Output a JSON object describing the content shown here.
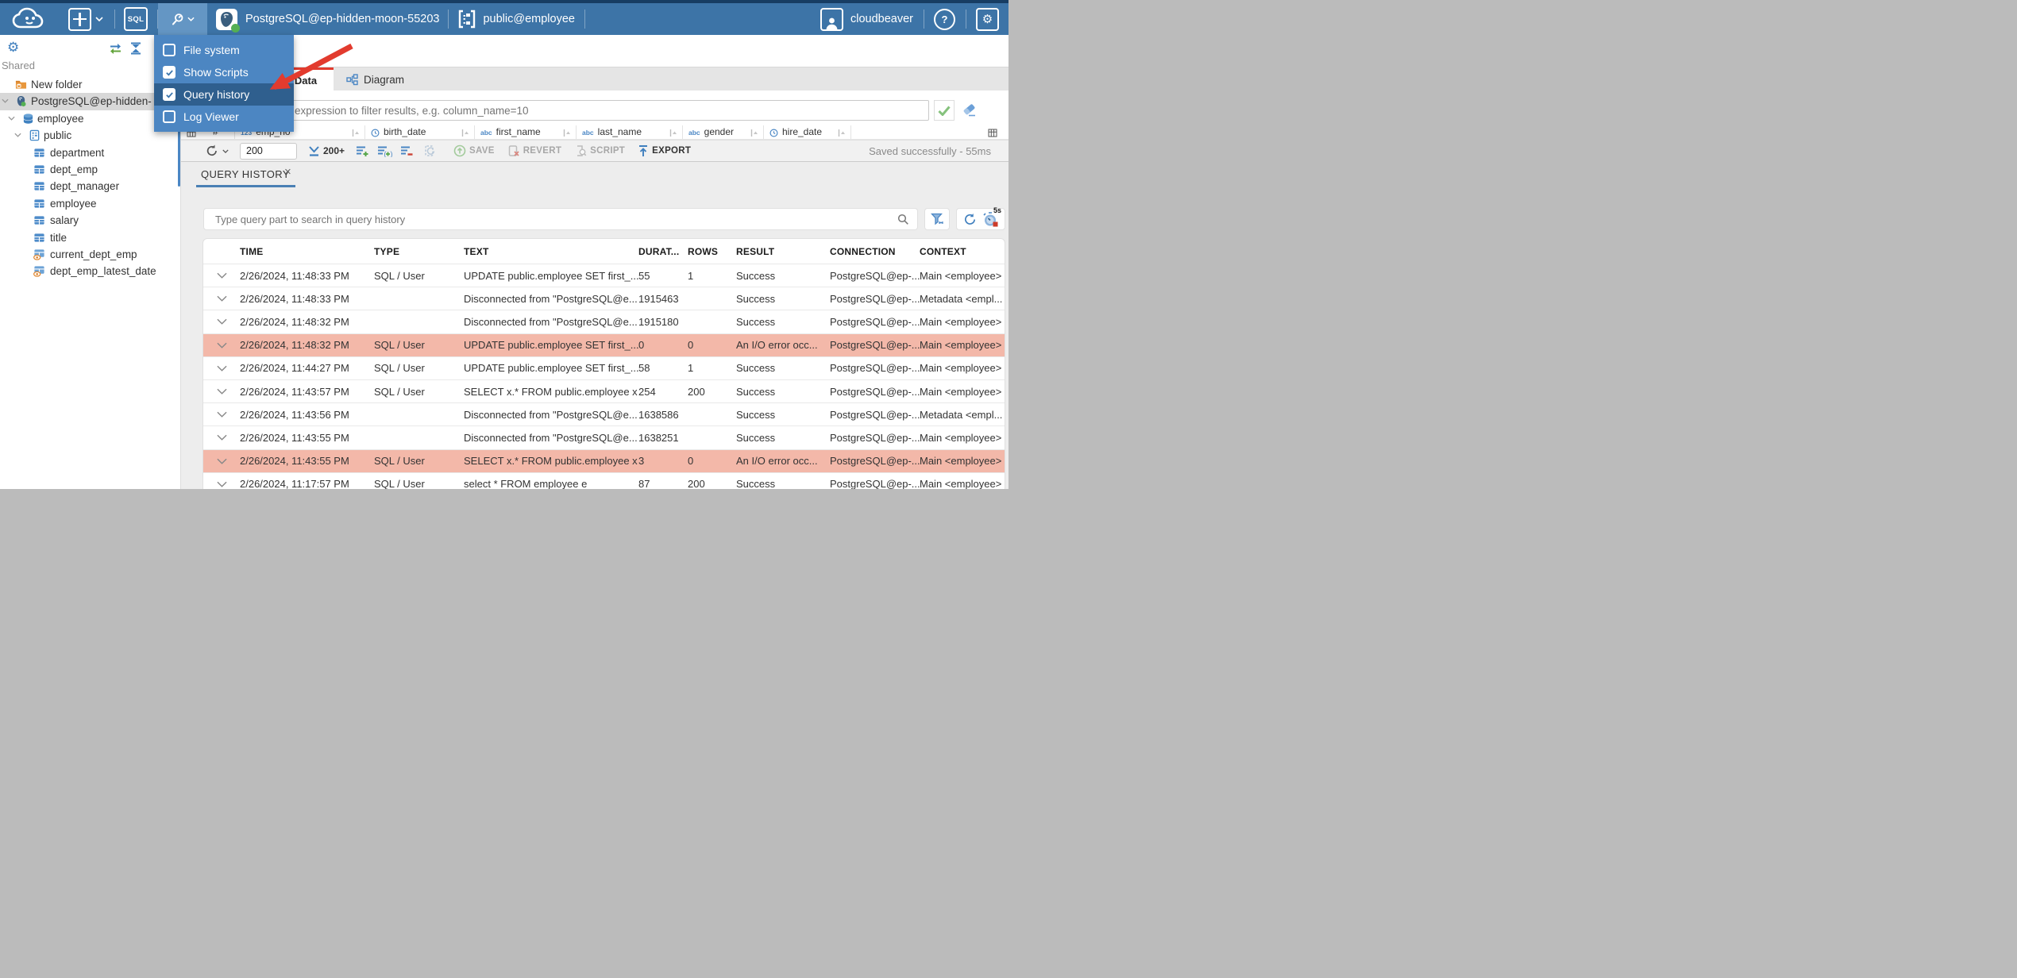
{
  "colors": {
    "topbar": "#3d74a7",
    "menu": "#4c86c2",
    "menu_highlight": "#2f5f8e",
    "accent_red": "#e23b2e",
    "error_row": "#f3b8a9",
    "icon_blue": "#4a86c4",
    "tab_underline": "#4a80b4",
    "status_green": "#55b054"
  },
  "topbar": {
    "sql_button": "SQL",
    "connection": "PostgreSQL@ep-hidden-moon-55203",
    "schema": "public@employee",
    "user": "cloudbeaver"
  },
  "tools_menu": {
    "items": [
      {
        "label": "File system",
        "checked": false,
        "highlighted": false
      },
      {
        "label": "Show Scripts",
        "checked": true,
        "highlighted": false
      },
      {
        "label": "Query history",
        "checked": true,
        "highlighted": true
      },
      {
        "label": "Log Viewer",
        "checked": false,
        "highlighted": false
      }
    ]
  },
  "sidebar": {
    "section_label": "Shared",
    "tree": [
      {
        "label": "New folder",
        "icon": "folder-icon",
        "level": 0,
        "chevron": false,
        "selected": false
      },
      {
        "label": "PostgreSQL@ep-hidden-",
        "icon": "postgres-connection-icon",
        "level": 0,
        "chevron": true,
        "selected": true
      },
      {
        "label": "employee",
        "icon": "database-icon",
        "level": 1,
        "chevron": true,
        "selected": false
      },
      {
        "label": "public",
        "icon": "schema-icon",
        "level": 2,
        "chevron": true,
        "selected": false
      },
      {
        "label": "department",
        "icon": "table-icon",
        "level": 3,
        "chevron": false,
        "selected": false
      },
      {
        "label": "dept_emp",
        "icon": "table-icon",
        "level": 3,
        "chevron": false,
        "selected": false
      },
      {
        "label": "dept_manager",
        "icon": "table-icon",
        "level": 3,
        "chevron": false,
        "selected": false
      },
      {
        "label": "employee",
        "icon": "table-icon",
        "level": 3,
        "chevron": false,
        "selected": false
      },
      {
        "label": "salary",
        "icon": "table-icon",
        "level": 3,
        "chevron": false,
        "selected": false
      },
      {
        "label": "title",
        "icon": "table-icon",
        "level": 3,
        "chevron": false,
        "selected": false
      },
      {
        "label": "current_dept_emp",
        "icon": "view-icon",
        "level": 3,
        "chevron": false,
        "selected": false
      },
      {
        "label": "dept_emp_latest_date",
        "icon": "view-icon",
        "level": 3,
        "chevron": false,
        "selected": false
      }
    ]
  },
  "editor": {
    "tabs": [
      {
        "label": "Data"
      },
      {
        "label": "Diagram"
      }
    ],
    "filter_placeholder": "expression to filter results, e.g. column_name=10",
    "grid_columns": [
      {
        "name": "#",
        "type": "none"
      },
      {
        "name": "emp_no",
        "type": "123"
      },
      {
        "name": "birth_date",
        "type": "clock"
      },
      {
        "name": "first_name",
        "type": "abc"
      },
      {
        "name": "last_name",
        "type": "abc"
      },
      {
        "name": "gender",
        "type": "abc"
      },
      {
        "name": "hire_date",
        "type": "clock"
      }
    ],
    "toolbar": {
      "row_limit": "200",
      "fetch_label": "200+",
      "save": "SAVE",
      "revert": "REVERT",
      "script": "SCRIPT",
      "export": "EXPORT",
      "status": "Saved successfully - 55ms"
    }
  },
  "query_history": {
    "tab_title": "QUERY HISTORY",
    "search_placeholder": "Type query part to search in query history",
    "refresh_interval": "5s",
    "columns": [
      "TIME",
      "TYPE",
      "TEXT",
      "DURAT...",
      "ROWS",
      "RESULT",
      "CONNECTION",
      "CONTEXT"
    ],
    "rows": [
      {
        "time": "2/26/2024, 11:48:33 PM",
        "type": "SQL / User",
        "text": "UPDATE public.employee SET first_...",
        "duration": "55",
        "rows": "1",
        "result": "Success",
        "connection": "PostgreSQL@ep-...",
        "context": "Main <employee>",
        "error": false
      },
      {
        "time": "2/26/2024, 11:48:33 PM",
        "type": "",
        "text": "Disconnected from \"PostgreSQL@e...",
        "duration": "1915463",
        "rows": "",
        "result": "Success",
        "connection": "PostgreSQL@ep-...",
        "context": "Metadata <empl...",
        "error": false
      },
      {
        "time": "2/26/2024, 11:48:32 PM",
        "type": "",
        "text": "Disconnected from \"PostgreSQL@e...",
        "duration": "1915180",
        "rows": "",
        "result": "Success",
        "connection": "PostgreSQL@ep-...",
        "context": "Main <employee>",
        "error": false
      },
      {
        "time": "2/26/2024, 11:48:32 PM",
        "type": "SQL / User",
        "text": "UPDATE public.employee SET first_...",
        "duration": "0",
        "rows": "0",
        "result": "An I/O error occ...",
        "connection": "PostgreSQL@ep-...",
        "context": "Main <employee>",
        "error": true
      },
      {
        "time": "2/26/2024, 11:44:27 PM",
        "type": "SQL / User",
        "text": "UPDATE public.employee SET first_...",
        "duration": "58",
        "rows": "1",
        "result": "Success",
        "connection": "PostgreSQL@ep-...",
        "context": "Main <employee>",
        "error": false
      },
      {
        "time": "2/26/2024, 11:43:57 PM",
        "type": "SQL / User",
        "text": "SELECT x.* FROM public.employee x",
        "duration": "254",
        "rows": "200",
        "result": "Success",
        "connection": "PostgreSQL@ep-...",
        "context": "Main <employee>",
        "error": false
      },
      {
        "time": "2/26/2024, 11:43:56 PM",
        "type": "",
        "text": "Disconnected from \"PostgreSQL@e...",
        "duration": "1638586",
        "rows": "",
        "result": "Success",
        "connection": "PostgreSQL@ep-...",
        "context": "Metadata <empl...",
        "error": false
      },
      {
        "time": "2/26/2024, 11:43:55 PM",
        "type": "",
        "text": "Disconnected from \"PostgreSQL@e...",
        "duration": "1638251",
        "rows": "",
        "result": "Success",
        "connection": "PostgreSQL@ep-...",
        "context": "Main <employee>",
        "error": false
      },
      {
        "time": "2/26/2024, 11:43:55 PM",
        "type": "SQL / User",
        "text": "SELECT x.* FROM public.employee x",
        "duration": "3",
        "rows": "0",
        "result": "An I/O error occ...",
        "connection": "PostgreSQL@ep-...",
        "context": "Main <employee>",
        "error": true
      },
      {
        "time": "2/26/2024, 11:17:57 PM",
        "type": "SQL / User",
        "text": "select * FROM employee e",
        "duration": "87",
        "rows": "200",
        "result": "Success",
        "connection": "PostgreSQL@ep-...",
        "context": "Main <employee>",
        "error": false
      }
    ]
  }
}
